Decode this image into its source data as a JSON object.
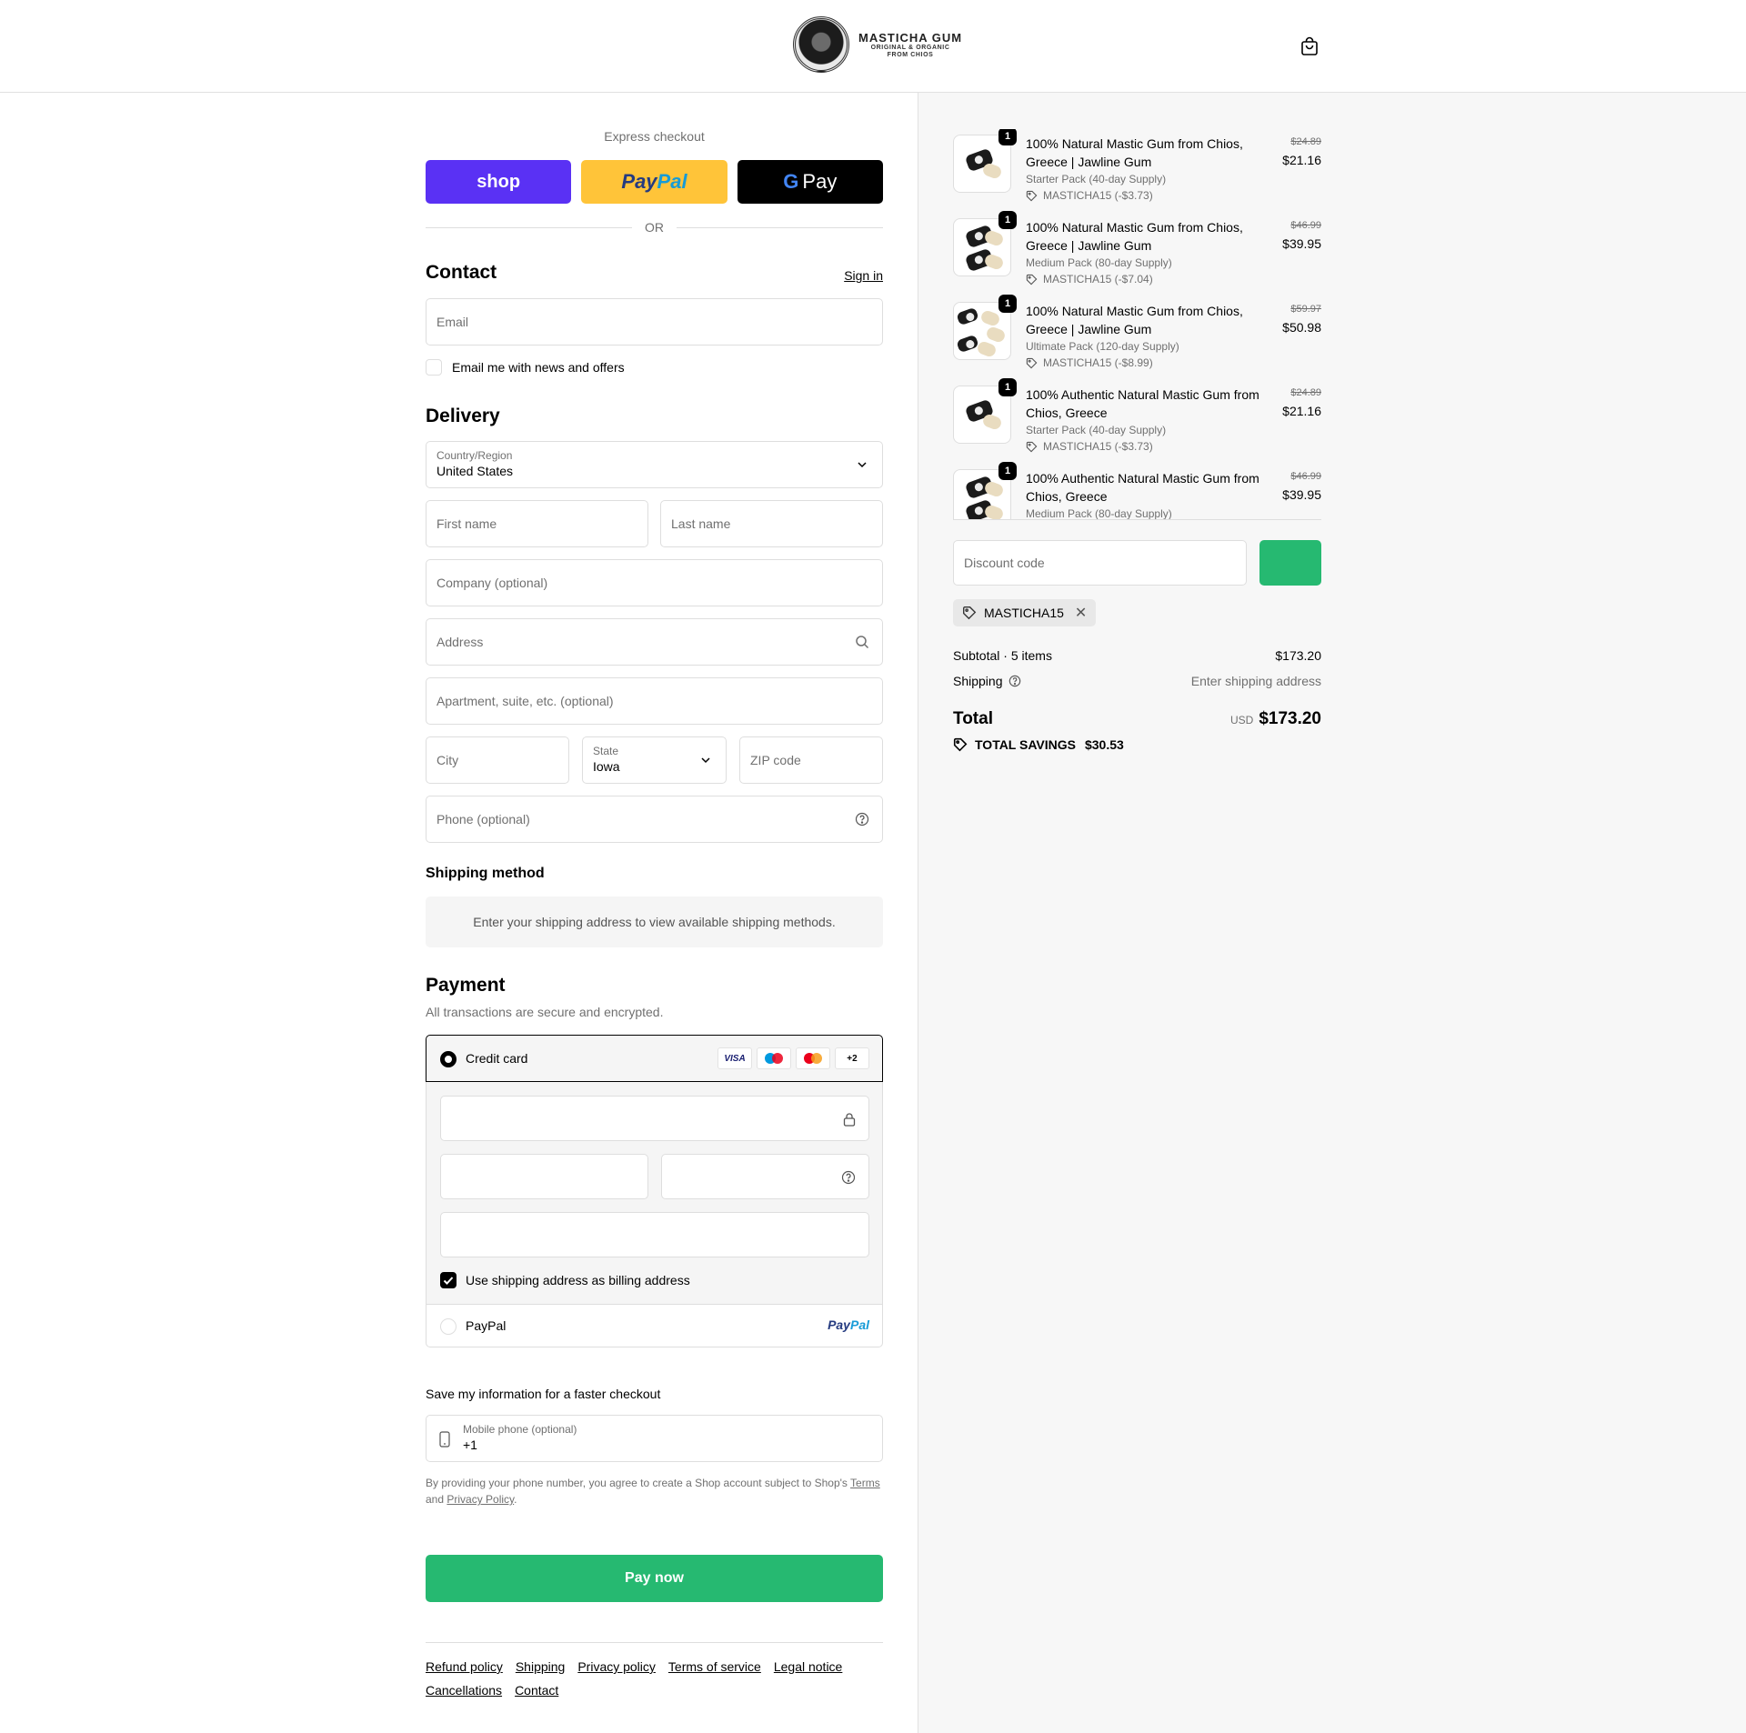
{
  "brand": {
    "name": "MASTICHA GUM",
    "tagline_1": "ORIGINAL & ORGANIC",
    "tagline_2": "FROM CHIOS"
  },
  "express": {
    "title": "Express checkout",
    "shop_label": "shop",
    "paypal_a": "Pay",
    "paypal_b": "Pal",
    "gpay_g": "G",
    "gpay_label": "Pay",
    "or": "OR"
  },
  "contact": {
    "title": "Contact",
    "sign_in": "Sign in",
    "email_placeholder": "Email",
    "news_label": "Email me with news and offers"
  },
  "delivery": {
    "title": "Delivery",
    "country_label": "Country/Region",
    "country_value": "United States",
    "first_name": "First name",
    "last_name": "Last name",
    "company": "Company (optional)",
    "address": "Address",
    "apartment": "Apartment, suite, etc. (optional)",
    "city": "City",
    "state_label": "State",
    "state_value": "Iowa",
    "zip": "ZIP code",
    "phone": "Phone (optional)"
  },
  "shipping_method": {
    "title": "Shipping method",
    "message": "Enter your shipping address to view available shipping methods."
  },
  "payment": {
    "title": "Payment",
    "subtitle": "All transactions are secure and encrypted.",
    "credit_card": "Credit card",
    "brands": [
      "VISA",
      "maestro",
      "mastercard",
      "+2"
    ],
    "billing_label": "Use shipping address as billing address",
    "paypal": "PayPal",
    "paypal_logo_a": "Pay",
    "paypal_logo_b": "Pal"
  },
  "save_info": {
    "title": "Save my information for a faster checkout",
    "mobile_label": "Mobile phone (optional)",
    "mobile_value": "+1",
    "legal_1": "By providing your phone number, you agree to create a Shop account subject to Shop's",
    "terms": "Terms",
    "legal_and": "and",
    "privacy": "Privacy Policy",
    "legal_end": "."
  },
  "pay_now": "Pay now",
  "footer": [
    "Refund policy",
    "Shipping",
    "Privacy policy",
    "Terms of service",
    "Legal notice",
    "Cancellations",
    "Contact"
  ],
  "items": [
    {
      "title": "100% Natural Mastic Gum from Chios, Greece | Jawline Gum",
      "variant": "Starter Pack (40-day Supply)",
      "discount": "MASTICHA15 (-$3.73)",
      "old_price": "$24.89",
      "price": "$21.16",
      "qty": "1"
    },
    {
      "title": "100% Natural Mastic Gum from Chios, Greece | Jawline Gum",
      "variant": "Medium Pack (80-day Supply)",
      "discount": "MASTICHA15 (-$7.04)",
      "old_price": "$46.99",
      "price": "$39.95",
      "qty": "1"
    },
    {
      "title": "100% Natural Mastic Gum from Chios, Greece | Jawline Gum",
      "variant": "Ultimate Pack (120-day Supply)",
      "discount": "MASTICHA15 (-$8.99)",
      "old_price": "$59.97",
      "price": "$50.98",
      "qty": "1"
    },
    {
      "title": "100% Authentic Natural Mastic Gum from Chios, Greece",
      "variant": "Starter Pack (40-day Supply)",
      "discount": "MASTICHA15 (-$3.73)",
      "old_price": "$24.89",
      "price": "$21.16",
      "qty": "1"
    },
    {
      "title": "100% Authentic Natural Mastic Gum from Chios, Greece",
      "variant": "Medium Pack (80-day Supply)",
      "discount": "",
      "old_price": "$46.99",
      "price": "$39.95",
      "qty": "1"
    }
  ],
  "summary": {
    "discount_placeholder": "Discount code",
    "applied_code": "MASTICHA15",
    "subtotal_label": "Subtotal · 5 items",
    "subtotal_value": "$173.20",
    "shipping_label": "Shipping",
    "shipping_value": "Enter shipping address",
    "total_label": "Total",
    "currency": "USD",
    "total_value": "$173.20",
    "savings_label": "TOTAL SAVINGS",
    "savings_value": "$30.53"
  },
  "colors": {
    "accent": "#26b971",
    "shop": "#5a31f4",
    "paypal": "#ffc439"
  }
}
